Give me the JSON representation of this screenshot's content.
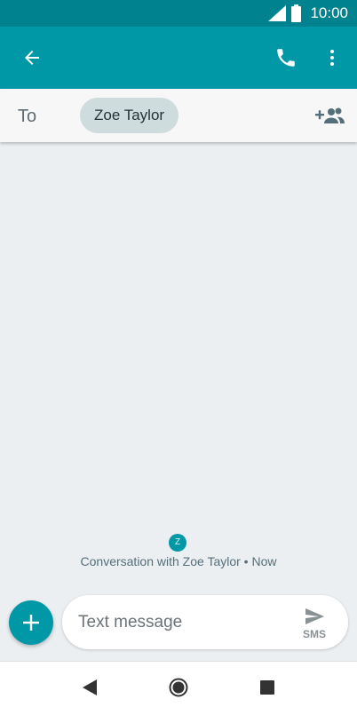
{
  "status_bar": {
    "time": "10:00"
  },
  "recipient": {
    "to_label": "To",
    "chip_name": "Zoe Taylor"
  },
  "conversation": {
    "avatar_initial": "Z",
    "info": "Conversation with Zoe Taylor • Now"
  },
  "compose": {
    "placeholder": "Text message",
    "send_type_label": "SMS"
  },
  "icons": {
    "back": "arrow-back-icon",
    "call": "phone-icon",
    "menu": "more-vert-icon",
    "add_recipient": "add-person-icon",
    "attach": "plus-icon",
    "send": "send-icon",
    "nav": [
      "back-triangle-icon",
      "home-circle-icon",
      "recents-square-icon"
    ]
  },
  "colors": {
    "status_bar": "#00838f",
    "toolbar": "#0097a7",
    "background": "#eceff1",
    "chip": "#cfdcdd"
  }
}
